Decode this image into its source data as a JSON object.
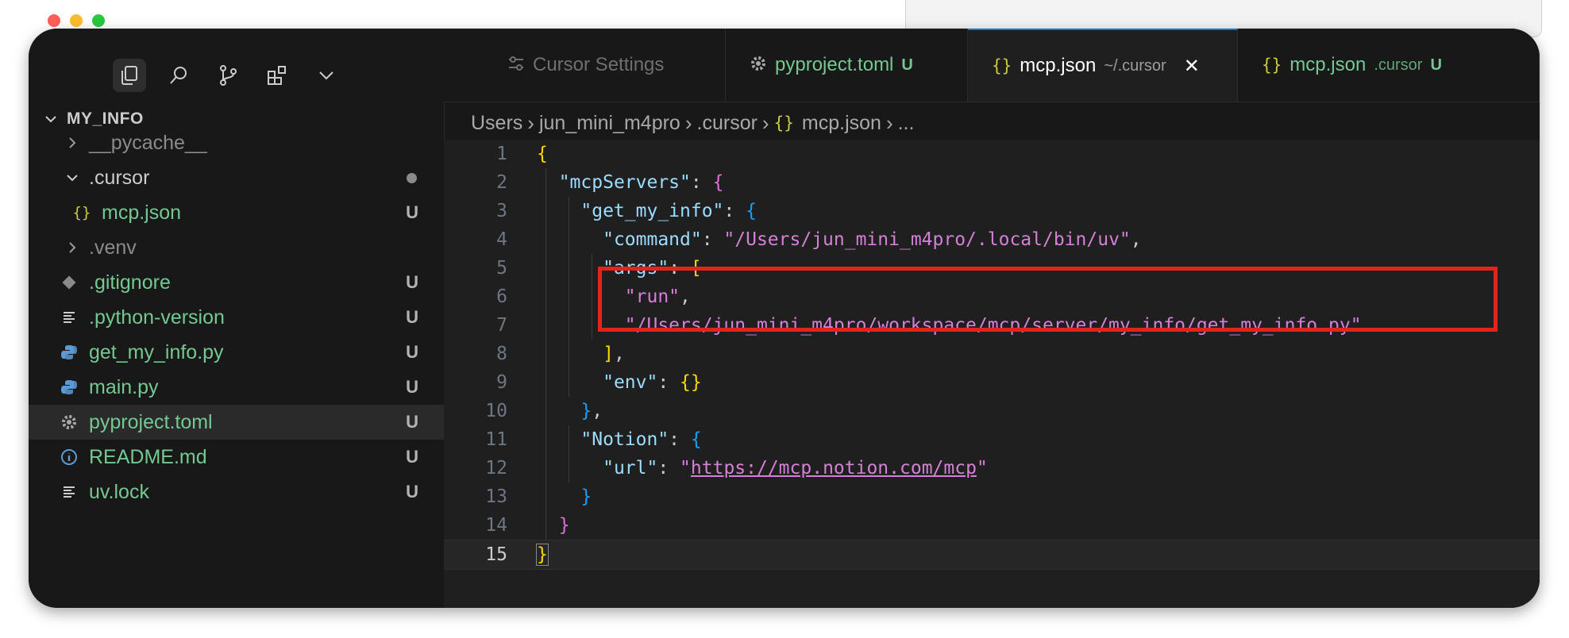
{
  "window": {
    "traffic_lights": [
      "close",
      "minimize",
      "maximize"
    ]
  },
  "activity_bar": {
    "icons": [
      "explorer-icon",
      "search-icon",
      "source-control-icon",
      "extensions-icon",
      "chevron-down-icon"
    ]
  },
  "explorer": {
    "section_title": "MY_INFO",
    "items": [
      {
        "label": "__pycache__",
        "icon": "chevron-right",
        "badge": "",
        "dim": true
      },
      {
        "label": ".cursor",
        "icon": "chevron-down",
        "badge": "dot",
        "dim": false
      },
      {
        "label": "mcp.json",
        "icon": "json-braces",
        "badge": "U",
        "dim": false
      },
      {
        "label": ".venv",
        "icon": "chevron-right",
        "badge": "",
        "dim": true
      },
      {
        "label": ".gitignore",
        "icon": "git-diamond",
        "badge": "U",
        "dim": false
      },
      {
        "label": ".python-version",
        "icon": "lines",
        "badge": "U",
        "dim": false
      },
      {
        "label": "get_my_info.py",
        "icon": "python",
        "badge": "U",
        "dim": false
      },
      {
        "label": "main.py",
        "icon": "python",
        "badge": "U",
        "dim": false
      },
      {
        "label": "pyproject.toml",
        "icon": "gear",
        "badge": "U",
        "dim": false,
        "selected": true
      },
      {
        "label": "README.md",
        "icon": "info",
        "badge": "U",
        "dim": false
      },
      {
        "label": "uv.lock",
        "icon": "lines",
        "badge": "U",
        "dim": false
      }
    ]
  },
  "tabs": [
    {
      "label": "Cursor Settings",
      "icon": "settings-sliders",
      "sub": "",
      "badge": "",
      "active": false
    },
    {
      "label": "pyproject.toml",
      "icon": "gear",
      "sub": "",
      "badge": "U",
      "active": false
    },
    {
      "label": "mcp.json",
      "icon": "{}",
      "sub": "~/.cursor",
      "badge": "",
      "active": true,
      "close": "✕"
    },
    {
      "label": "mcp.json",
      "icon": "{}",
      "sub": ".cursor",
      "badge": "U",
      "active": false
    }
  ],
  "breadcrumb": {
    "parts": [
      "Users",
      "jun_mini_m4pro",
      ".cursor",
      "{}",
      "mcp.json",
      "..."
    ]
  },
  "editor": {
    "current_line": 15,
    "line_numbers": [
      "1",
      "2",
      "3",
      "4",
      "5",
      "6",
      "7",
      "8",
      "9",
      "10",
      "11",
      "12",
      "13",
      "14",
      "15"
    ],
    "tokens": {
      "l1_open": "{",
      "l2_key": "\"mcpServers\"",
      "l2_colon": ": ",
      "l2_open": "{",
      "l3_key": "\"get_my_info\"",
      "l3_colon": ": ",
      "l3_open": "{",
      "l4_key": "\"command\"",
      "l4_colon": ": ",
      "l4_val": "\"/Users/jun_mini_m4pro/.local/bin/uv\"",
      "l4_comma": ",",
      "l5_key": "\"args\"",
      "l5_colon": ": ",
      "l5_open": "[",
      "l6_val": "\"run\"",
      "l6_comma": ",",
      "l7_val": "\"/Users/jun_mini_m4pro/workspace/mcp/server/my_info/get_my_info.py\"",
      "l8_close": "]",
      "l8_comma": ",",
      "l9_key": "\"env\"",
      "l9_colon": ": ",
      "l9_val": "{}",
      "l10_close": "}",
      "l10_comma": ",",
      "l11_key": "\"Notion\"",
      "l11_colon": ": ",
      "l11_open": "{",
      "l12_key": "\"url\"",
      "l12_colon": ": ",
      "l12_q1": "\"",
      "l12_url": "https://mcp.notion.com/mcp",
      "l12_q2": "\"",
      "l13_close": "}",
      "l14_close": "}",
      "l15_close": "}"
    }
  },
  "annotation": {
    "highlight_color": "#e1251b"
  }
}
